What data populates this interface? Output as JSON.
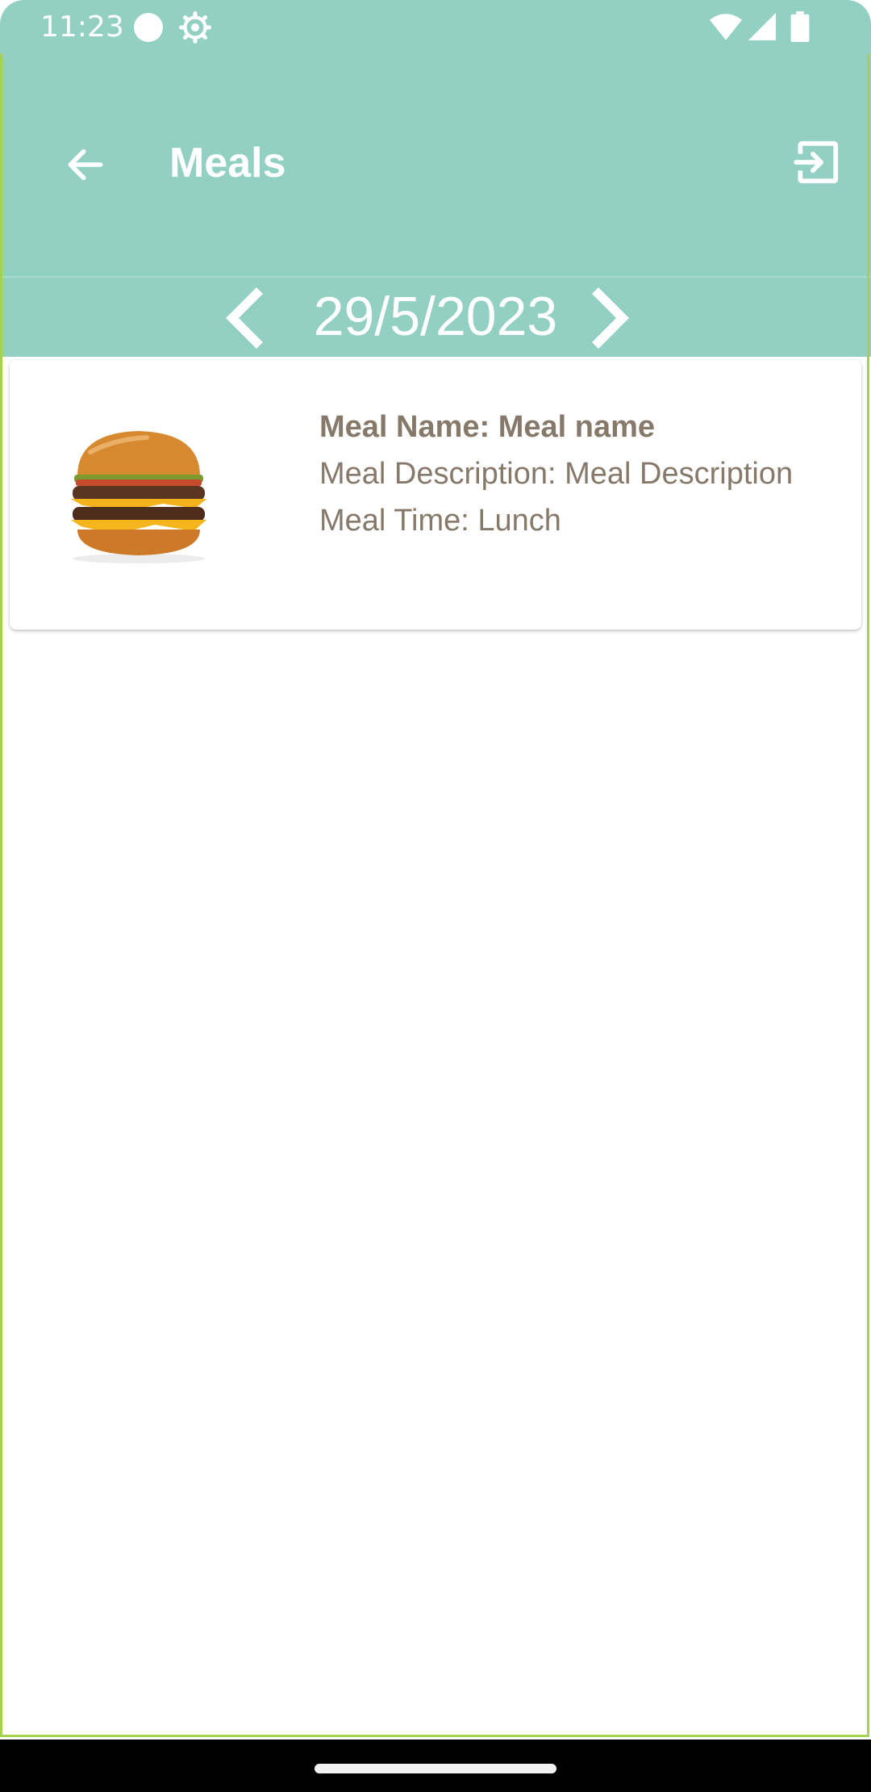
{
  "status_bar": {
    "time": "11:23",
    "icons": [
      "record-dot-icon",
      "gear-icon",
      "wifi-icon",
      "signal-icon",
      "battery-icon"
    ]
  },
  "app_bar": {
    "title": "Meals",
    "back_icon": "arrow-left-icon",
    "exit_icon": "exit-to-app-icon"
  },
  "date_nav": {
    "date": "29/5/2023",
    "prev_icon": "chevron-left-icon",
    "next_icon": "chevron-right-icon"
  },
  "meals": [
    {
      "name_line": "Meal Name: Meal name",
      "description_line": "Meal Description: Meal Description",
      "time_line": "Meal Time: Lunch",
      "image": "burger-image"
    }
  ],
  "colors": {
    "header": "#93d0c4",
    "accent_border": "#a6d24e",
    "meal_text": "#86796a"
  }
}
